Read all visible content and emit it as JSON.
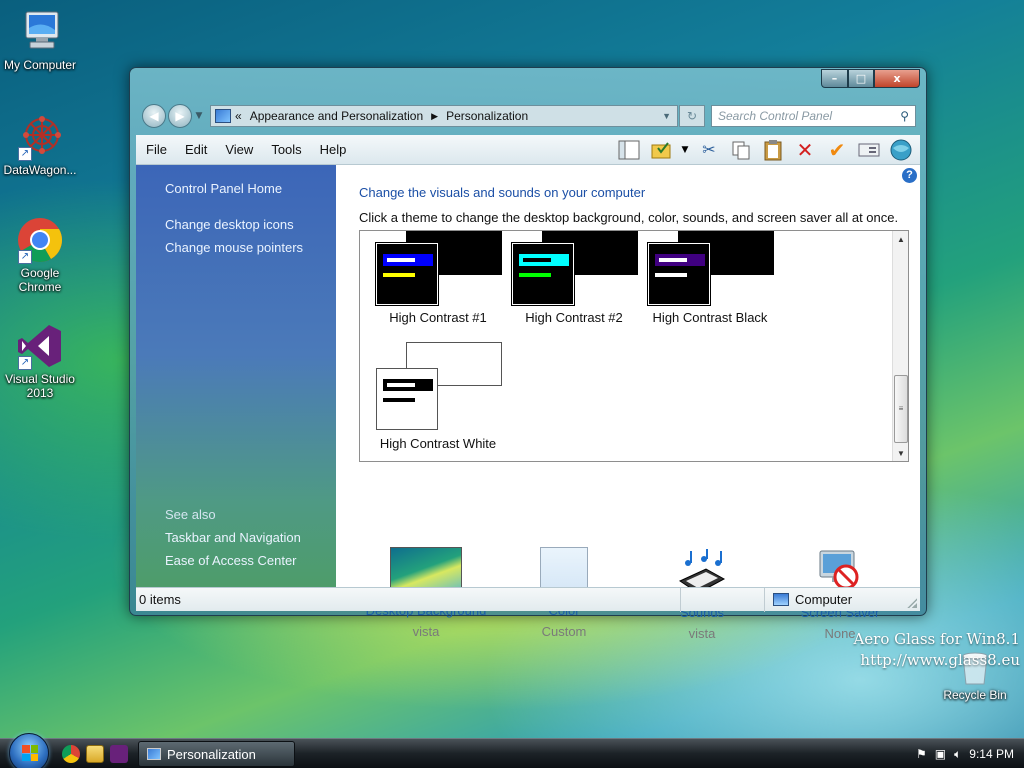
{
  "desktop": {
    "icons": [
      {
        "label": "My Computer",
        "icon": "computer-icon"
      },
      {
        "label": "DataWagon...",
        "icon": "datawagon-icon"
      },
      {
        "label": "Google Chrome",
        "icon": "chrome-icon"
      },
      {
        "label": "Visual Studio 2013",
        "icon": "visual-studio-icon"
      }
    ],
    "recycle_bin": "Recycle Bin",
    "watermark_line1": "Aero Glass for Win8.1",
    "watermark_line2": "http://www.glass8.eu"
  },
  "window": {
    "title": "Personalization",
    "controls": {
      "minimize": "–",
      "maximize": "□",
      "close": "x"
    },
    "breadcrumb": {
      "overflow": "«",
      "parent": "Appearance and Personalization",
      "current": "Personalization"
    },
    "search": {
      "placeholder": "Search Control Panel"
    },
    "menu": [
      "File",
      "Edit",
      "View",
      "Tools",
      "Help"
    ],
    "toolbar_icons": [
      "layout-icon",
      "folder-check-icon",
      "dropdown-icon",
      "cut-icon",
      "copy-icon",
      "paste-icon",
      "delete-icon",
      "properties-icon",
      "card-icon",
      "globe-icon"
    ]
  },
  "sidebar": {
    "home": "Control Panel Home",
    "links": [
      "Change desktop icons",
      "Change mouse pointers"
    ],
    "see_also_title": "See also",
    "see_also": [
      "Taskbar and Navigation",
      "Ease of Access Center"
    ]
  },
  "content": {
    "title": "Change the visuals and sounds on your computer",
    "subtitle": "Click a theme to change the desktop background, color, sounds, and screen saver all at once.",
    "themes": [
      {
        "name": "High Contrast #1",
        "bg": "#000000",
        "bar": "#0000ff",
        "line": "#ffffff",
        "accent": "#ffff00",
        "frame": "#000000"
      },
      {
        "name": "High Contrast #2",
        "bg": "#000000",
        "bar": "#00ffff",
        "line": "#000000",
        "accent": "#00ff00",
        "frame": "#000000"
      },
      {
        "name": "High Contrast Black",
        "bg": "#000000",
        "bar": "#400080",
        "line": "#ffffff",
        "accent": "#ffffff",
        "frame": "#000000"
      },
      {
        "name": "High Contrast White",
        "bg": "#ffffff",
        "bar": "#000000",
        "line": "#ffffff",
        "accent": "#000000",
        "frame": "#555555"
      }
    ],
    "settings": [
      {
        "name": "Desktop Background",
        "value": "vista",
        "icon": "desktop-background-icon"
      },
      {
        "name": "Color",
        "value": "Custom",
        "icon": "color-swatch-icon"
      },
      {
        "name": "Sounds",
        "value": "vista",
        "icon": "sounds-icon"
      },
      {
        "name": "Screen Saver",
        "value": "None",
        "icon": "screen-saver-icon"
      }
    ]
  },
  "statusbar": {
    "items": "0 items",
    "location": "Computer"
  },
  "taskbar": {
    "task": "Personalization",
    "time": "9:14 PM"
  }
}
